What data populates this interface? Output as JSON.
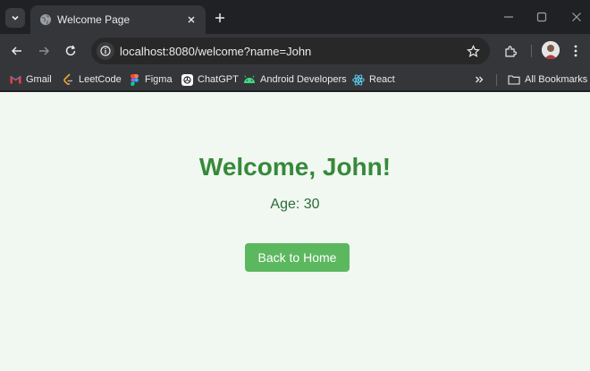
{
  "browser": {
    "tab": {
      "title": "Welcome Page"
    },
    "omnibox": {
      "url": "localhost:8080/welcome?name=John"
    },
    "bookmarks": [
      {
        "label": "Gmail",
        "icon": "gmail-icon"
      },
      {
        "label": "LeetCode",
        "icon": "leetcode-icon"
      },
      {
        "label": "Figma",
        "icon": "figma-icon"
      },
      {
        "label": "ChatGPT",
        "icon": "chatgpt-icon"
      },
      {
        "label": "Android Developers",
        "icon": "android-icon"
      },
      {
        "label": "React",
        "icon": "react-icon"
      }
    ],
    "all_bookmarks_label": "All Bookmarks"
  },
  "page": {
    "heading": "Welcome, John!",
    "age_text": "Age: 30",
    "back_button_label": "Back to Home"
  },
  "colors": {
    "page_background": "#f1f8f2",
    "heading": "#37893a",
    "button": "#5cb85f",
    "chrome_dark": "#202124",
    "chrome_toolbar": "#35363a"
  }
}
